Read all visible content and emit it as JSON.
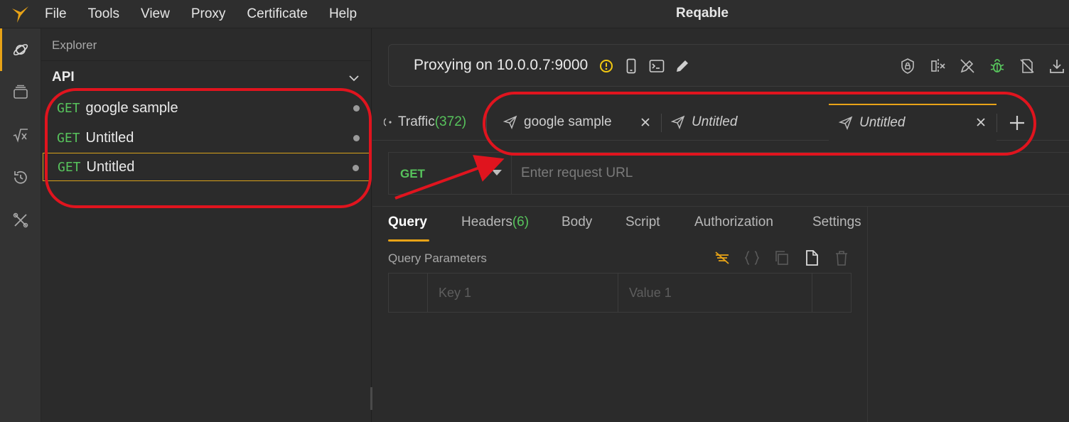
{
  "app": {
    "title": "Reqable",
    "logo_icon": "reqable-bird-logo",
    "accent_color": "#e8a317",
    "green_color": "#57c35c",
    "annotation_color": "#e0141e"
  },
  "menu": {
    "items": [
      "File",
      "Tools",
      "View",
      "Proxy",
      "Certificate",
      "Help"
    ]
  },
  "rail": {
    "items": [
      {
        "icon": "planet-icon",
        "active": true
      },
      {
        "icon": "stack-icon",
        "active": false
      },
      {
        "icon": "math-sqrt-icon",
        "active": false
      },
      {
        "icon": "history-icon",
        "active": false
      },
      {
        "icon": "tools-icon",
        "active": false
      }
    ]
  },
  "explorer": {
    "title": "Explorer",
    "section": "API",
    "items": [
      {
        "method": "GET",
        "name": "google sample",
        "selected": false
      },
      {
        "method": "GET",
        "name": "Untitled",
        "selected": false
      },
      {
        "method": "GET",
        "name": "Untitled",
        "selected": true
      }
    ]
  },
  "proxy": {
    "status": "Proxying on 10.0.0.7:9000",
    "icons": [
      "warning-icon",
      "mobile-icon",
      "terminal-icon",
      "edit-icon",
      "shield-lock-icon",
      "split-icon",
      "pen-off-icon",
      "bug-icon",
      "ssl-off-icon",
      "download-icon"
    ]
  },
  "tabs": {
    "traffic_label": "Traffic",
    "traffic_count": "(372)",
    "items": [
      {
        "label": "google sample",
        "italic": false,
        "closable": true
      },
      {
        "label": "Untitled",
        "italic": true,
        "closable": false
      },
      {
        "label": "Untitled",
        "italic": true,
        "closable": true,
        "active": true
      }
    ],
    "add_label": "+"
  },
  "request": {
    "method": "GET",
    "url_placeholder": "Enter request URL",
    "tabs": {
      "query": "Query",
      "headers": "Headers",
      "headers_count": "(6)",
      "body": "Body",
      "script": "Script",
      "authorization": "Authorization",
      "settings": "Settings"
    },
    "query_params_label": "Query Parameters",
    "key_placeholder": "Key 1",
    "value_placeholder": "Value 1"
  }
}
